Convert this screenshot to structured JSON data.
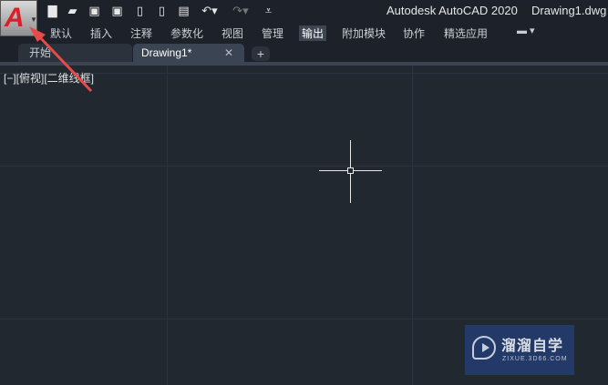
{
  "window": {
    "app_title": "Autodesk AutoCAD 2020",
    "file_title": "Drawing1.dwg"
  },
  "app_menu": {
    "letter": "A"
  },
  "quick_access": [
    "new-icon",
    "open-icon",
    "save-icon",
    "save-as-icon",
    "open-web-icon",
    "save-web-icon",
    "plot-icon",
    "undo-icon",
    "redo-icon",
    "customize-icon"
  ],
  "ribbon_tabs": [
    "默认",
    "插入",
    "注释",
    "参数化",
    "视图",
    "管理",
    "输出",
    "附加模块",
    "协作",
    "精选应用"
  ],
  "active_ribbon_tab": "输出",
  "file_tabs": {
    "start": "开始",
    "drawing": "Drawing1*",
    "close": "✕",
    "add": "+"
  },
  "viewport": {
    "label": "[−][俯视][二维线框]"
  },
  "watermark": {
    "name": "溜溜自学",
    "url": "ZIXUE.3D66.COM"
  },
  "colors": {
    "annotation_arrow": "#e84a4a",
    "background": "#212830"
  }
}
